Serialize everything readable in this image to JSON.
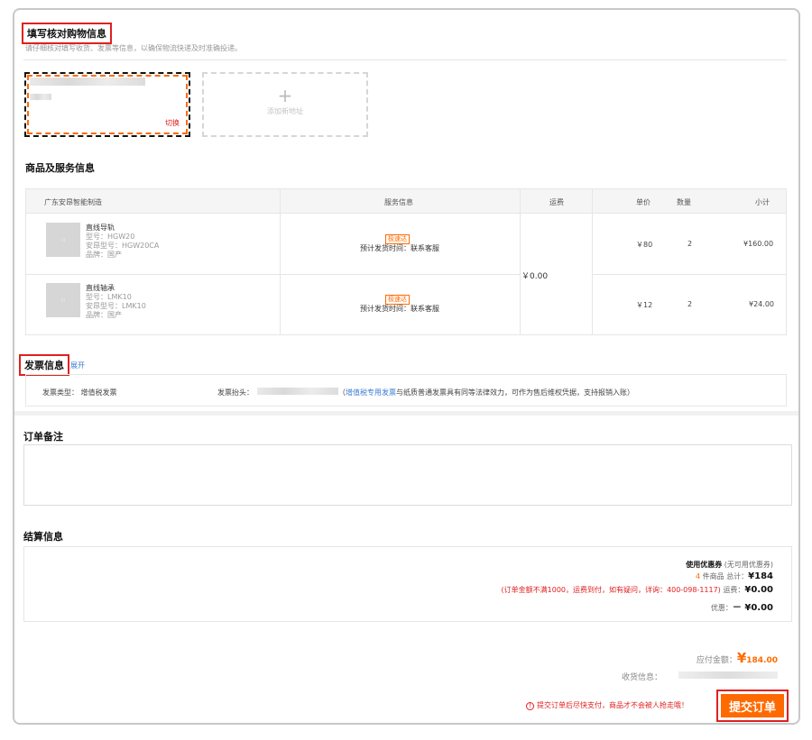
{
  "header": {
    "title": "填写核对购物信息",
    "subtitle": "请仔细核对填写收货、发票等信息，以确保物流快递及时准确投递。"
  },
  "address": {
    "switch_label": "切换",
    "add_label": "添加新地址"
  },
  "products": {
    "section_title": "商品及服务信息",
    "headers": {
      "shop": "广东安昂智能制造",
      "service": "服务信息",
      "freight": "运费",
      "unit_price": "单价",
      "qty": "数量",
      "subtotal": "小计"
    },
    "freight_value": "￥0.00",
    "rows": [
      {
        "name": "直线导轨",
        "model": "型号：HGW20",
        "anang_model": "安昂型号：HGW20CA",
        "brand": "品牌：国产",
        "badge": "极速达",
        "ship": "预计发货时间：联系客服",
        "price": "￥80",
        "qty": "2",
        "subtotal": "¥160.00"
      },
      {
        "name": "直线轴承",
        "model": "型号：LMK10",
        "anang_model": "安昂型号：LMK10",
        "brand": "品牌：国产",
        "badge": "极速达",
        "ship": "预计发货时间：联系客服",
        "price": "￥12",
        "qty": "2",
        "subtotal": "¥24.00"
      }
    ]
  },
  "invoice": {
    "section_title": "发票信息",
    "expand_label": "展开",
    "type_text": "发票类型：  增值税发票",
    "header_label": "发票抬头：",
    "link_text": "增值税专用发票",
    "desc_prefix": "（",
    "desc_suffix": "与纸质普通发票具有同等法律效力，可作为售后维权凭据，支持报销入账）"
  },
  "remark": {
    "section_title": "订单备注"
  },
  "settlement": {
    "section_title": "结算信息",
    "coupon_label": "使用优惠券",
    "coupon_note": "(无可用优惠券)",
    "item_count": "4",
    "items_label": "件商品  总计：",
    "total": "¥184",
    "freight_note": "(订单金额不满1000，运费到付，如有疑问，详询：400-098-1117)",
    "freight_label": "运费：",
    "freight_value": "¥0.00",
    "discount_label": "优惠：",
    "discount_value": "－ ¥0.00"
  },
  "payment": {
    "payable_label": "应付金额：",
    "payable_symbol": "¥",
    "payable_value": "184.00",
    "receiver_label": "收货信息：",
    "warning": "提交订单后尽快支付，商品才不会被人抢走哦！",
    "warning_icon": "!",
    "submit_label": "提交订单"
  },
  "colors": {
    "accent": "#ff6a00",
    "highlight": "#e02020",
    "link": "#3a7bd5"
  }
}
